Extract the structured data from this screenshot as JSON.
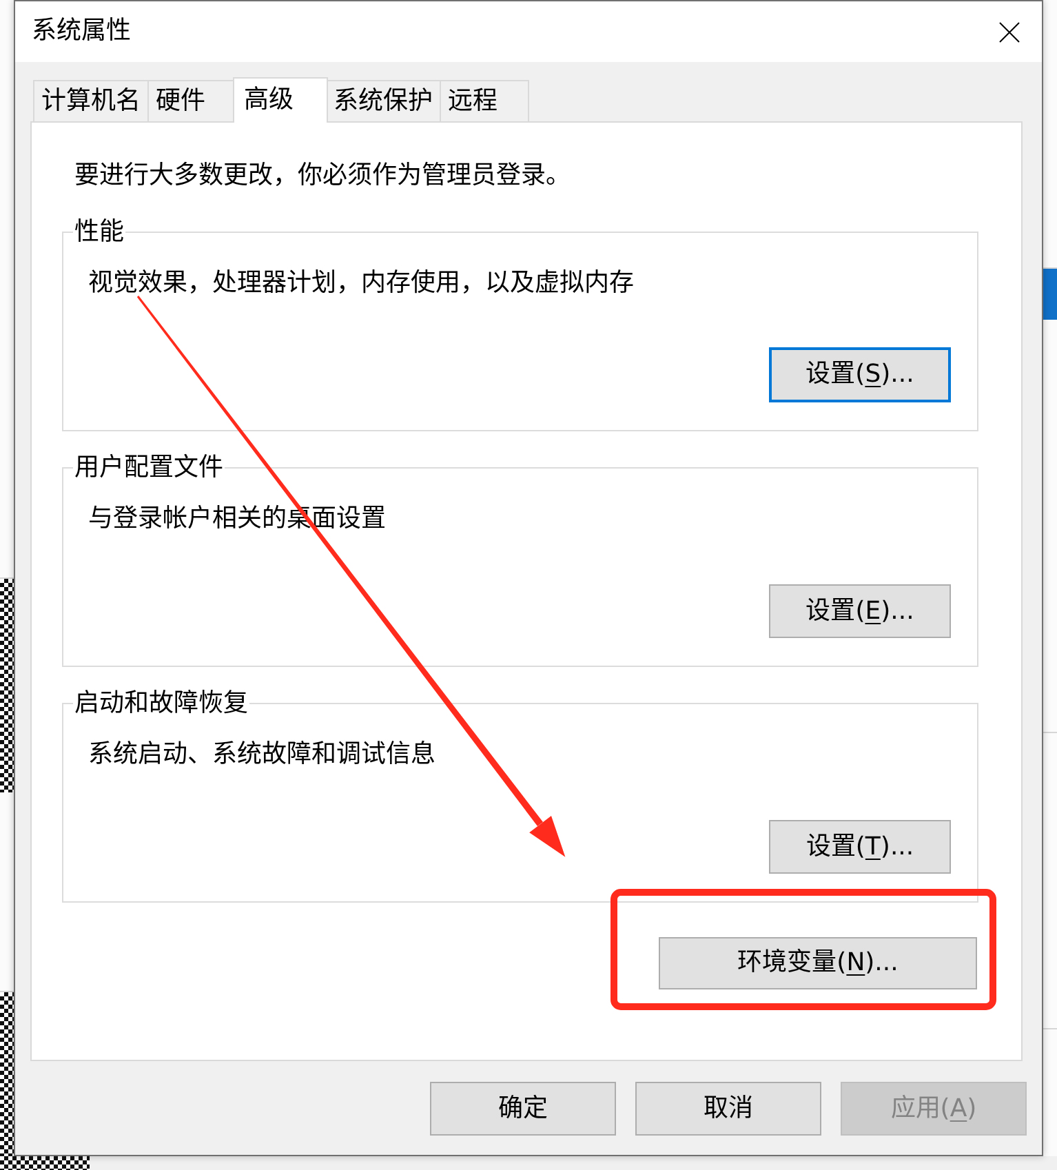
{
  "window": {
    "title": "系统属性"
  },
  "tabs": [
    {
      "label": "计算机名",
      "selected": false
    },
    {
      "label": "硬件",
      "selected": false
    },
    {
      "label": "高级",
      "selected": true
    },
    {
      "label": "系统保护",
      "selected": false
    },
    {
      "label": "远程",
      "selected": false
    }
  ],
  "notice": "要进行大多数更改，你必须作为管理员登录。",
  "groups": [
    {
      "title": "性能",
      "description": "视觉效果，处理器计划，内存使用，以及虚拟内存",
      "button": {
        "label_parts": [
          {
            "text": "设置(",
            "access_key": false
          },
          {
            "text": "S",
            "access_key": true
          },
          {
            "text": ")...",
            "access_key": false
          }
        ],
        "default": true
      }
    },
    {
      "title": "用户配置文件",
      "description": "与登录帐户相关的桌面设置",
      "button": {
        "label_parts": [
          {
            "text": "设置(",
            "access_key": false
          },
          {
            "text": "E",
            "access_key": true
          },
          {
            "text": ")...",
            "access_key": false
          }
        ],
        "default": false
      }
    },
    {
      "title": "启动和故障恢复",
      "description": "系统启动、系统故障和调试信息",
      "button": {
        "label_parts": [
          {
            "text": "设置(",
            "access_key": false
          },
          {
            "text": "T",
            "access_key": true
          },
          {
            "text": ")...",
            "access_key": false
          }
        ],
        "default": false
      }
    }
  ],
  "environment_button": {
    "label_parts": [
      {
        "text": "环境变量(",
        "access_key": false
      },
      {
        "text": "N",
        "access_key": true
      },
      {
        "text": ")...",
        "access_key": false
      }
    ],
    "default": false,
    "highlighted": true
  },
  "footer_buttons": [
    {
      "label_parts": [
        {
          "text": "确定",
          "access_key": false
        }
      ],
      "disabled": false
    },
    {
      "label_parts": [
        {
          "text": "取消",
          "access_key": false
        }
      ],
      "disabled": false
    },
    {
      "label_parts": [
        {
          "text": "应用(",
          "access_key": false
        },
        {
          "text": "A",
          "access_key": true
        },
        {
          "text": ")",
          "access_key": false
        }
      ],
      "disabled": true
    }
  ]
}
